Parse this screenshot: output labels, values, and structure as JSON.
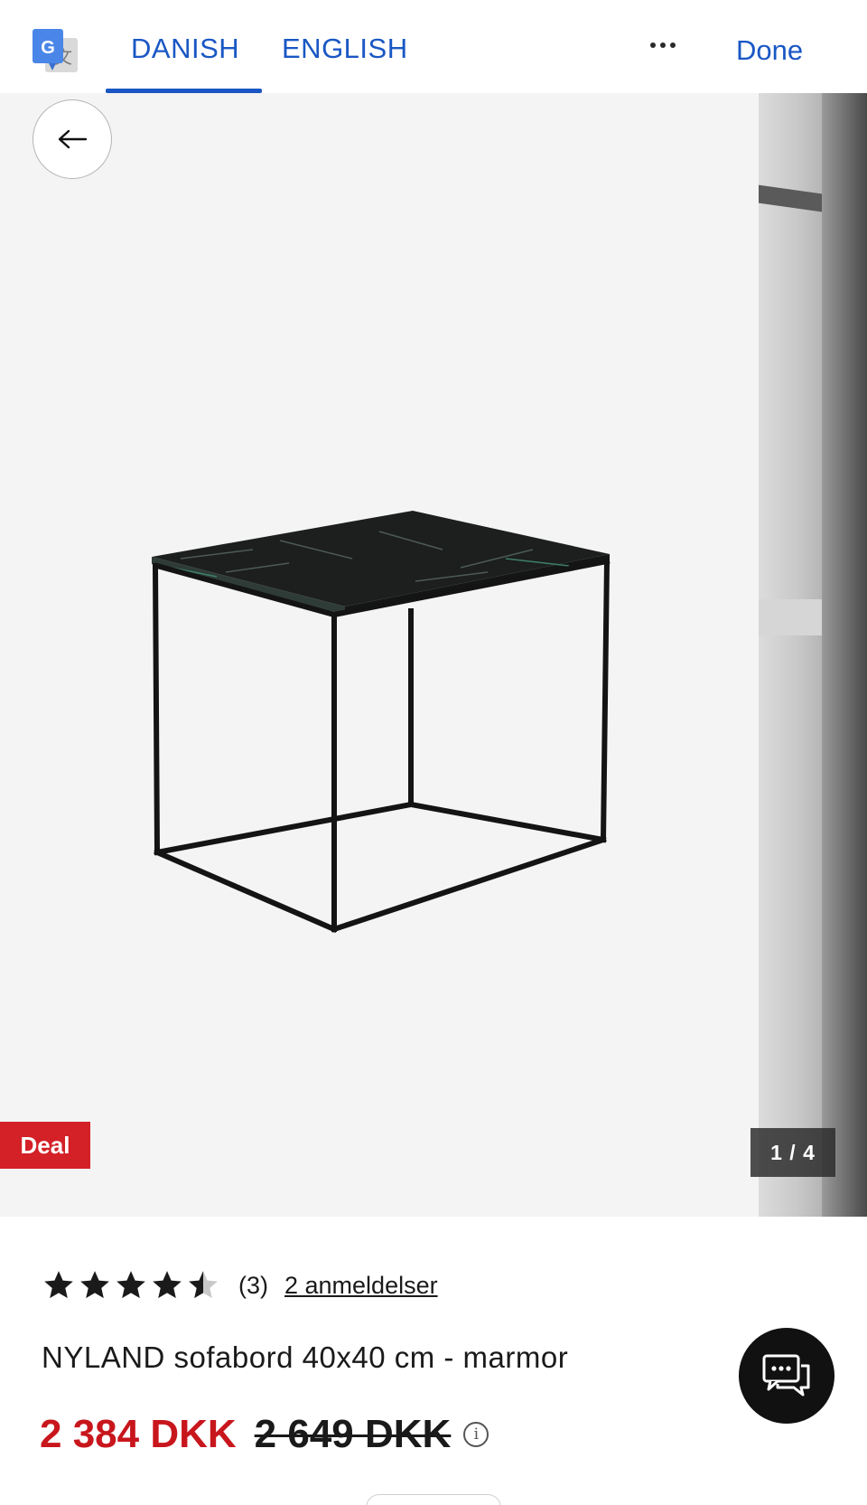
{
  "topbar": {
    "logo_icon": "google-translate-icon",
    "tabs": [
      {
        "label": "DANISH",
        "active": true
      },
      {
        "label": "ENGLISH",
        "active": false
      }
    ],
    "more_icon": "more-horizontal-icon",
    "done_label": "Done",
    "accent_color": "#1a57c4"
  },
  "gallery": {
    "back_icon": "arrow-left-icon",
    "badge": "Deal",
    "counter": "1 / 4",
    "badge_color": "#d42027"
  },
  "product": {
    "rating": 4.5,
    "rating_max": 5,
    "rating_count": "(3)",
    "reviews_link": "2 anmeldelser",
    "title": "NYLAND sofabord 40x40 cm - marmor",
    "price_now": "2 384 DKK",
    "price_old": "2 649 DKK",
    "info_icon": "info-icon",
    "price_color": "#c8161d"
  },
  "chat": {
    "icon": "chat-bubbles-icon"
  }
}
